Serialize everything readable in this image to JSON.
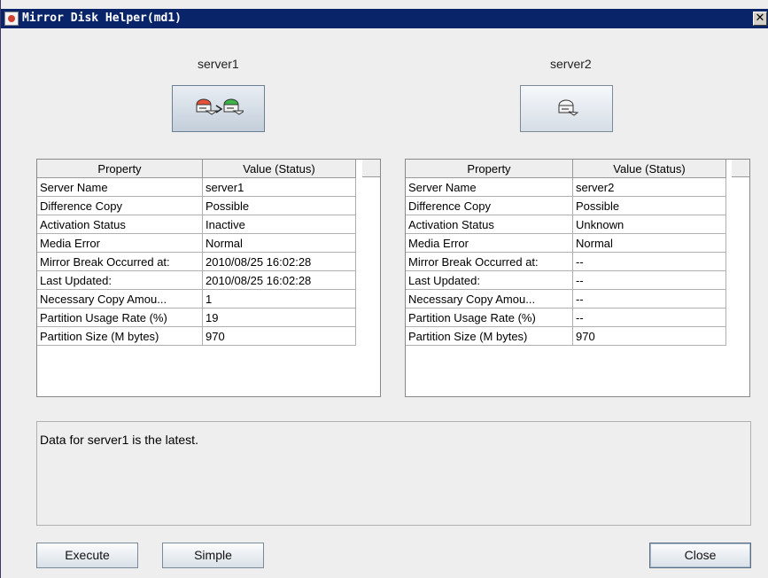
{
  "window": {
    "title": "Mirror Disk Helper(md1)",
    "close_glyph": "✕"
  },
  "servers": [
    {
      "label": "server1",
      "icon": "disk-copy-icon",
      "table": {
        "headers": [
          "Property",
          "Value (Status)"
        ],
        "rows": [
          [
            "Server Name",
            "server1"
          ],
          [
            "Difference Copy",
            "Possible"
          ],
          [
            "Activation Status",
            "Inactive"
          ],
          [
            "Media Error",
            "Normal"
          ],
          [
            "Mirror Break Occurred at:",
            "2010/08/25 16:02:28"
          ],
          [
            "Last Updated:",
            "2010/08/25 16:02:28"
          ],
          [
            "Necessary Copy Amou...",
            "1"
          ],
          [
            "Partition Usage Rate (%)",
            "19"
          ],
          [
            "Partition Size (M bytes)",
            "970"
          ]
        ]
      }
    },
    {
      "label": "server2",
      "icon": "disk-icon",
      "table": {
        "headers": [
          "Property",
          "Value (Status)"
        ],
        "rows": [
          [
            "Server Name",
            "server2"
          ],
          [
            "Difference Copy",
            "Possible"
          ],
          [
            "Activation Status",
            "Unknown"
          ],
          [
            "Media Error",
            "Normal"
          ],
          [
            "Mirror Break Occurred at:",
            "--"
          ],
          [
            "Last Updated:",
            "--"
          ],
          [
            "Necessary Copy Amou...",
            "--"
          ],
          [
            "Partition Usage Rate (%)",
            "--"
          ],
          [
            "Partition Size (M bytes)",
            "970"
          ]
        ]
      }
    }
  ],
  "message": "Data for server1 is the latest.",
  "buttons": {
    "execute": "Execute",
    "simple": "Simple",
    "close": "Close"
  },
  "colors": {
    "titlebar": "#0a246a",
    "source_disk": "#e8503a",
    "target_disk": "#3cb44a"
  }
}
